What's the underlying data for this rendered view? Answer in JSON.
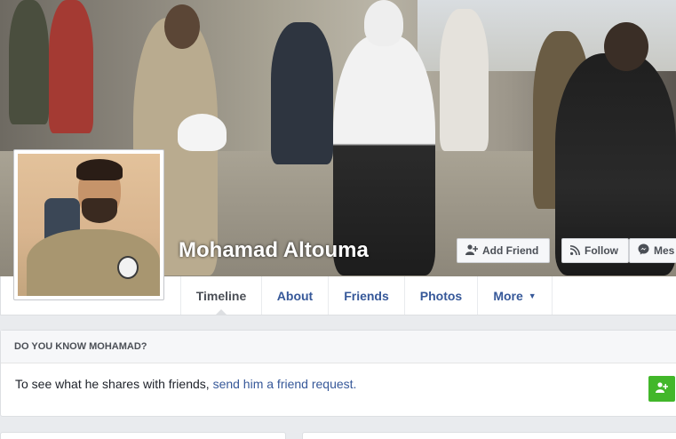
{
  "profile": {
    "name": "Mohamad Altouma"
  },
  "actions": {
    "add_friend": "Add Friend",
    "follow": "Follow",
    "message": "Mes"
  },
  "tabs": [
    {
      "label": "Timeline",
      "active": true
    },
    {
      "label": "About"
    },
    {
      "label": "Friends"
    },
    {
      "label": "Photos"
    },
    {
      "label": "More"
    }
  ],
  "know_card": {
    "title": "DO YOU KNOW MOHAMAD?",
    "text_before": "To see what he shares with friends, ",
    "link_text": "send him a friend request."
  },
  "colors": {
    "link": "#365899",
    "add_green": "#42b72a"
  },
  "icons": [
    "add-friend-icon",
    "rss-follow-icon",
    "messenger-icon",
    "caret-down-icon"
  ]
}
